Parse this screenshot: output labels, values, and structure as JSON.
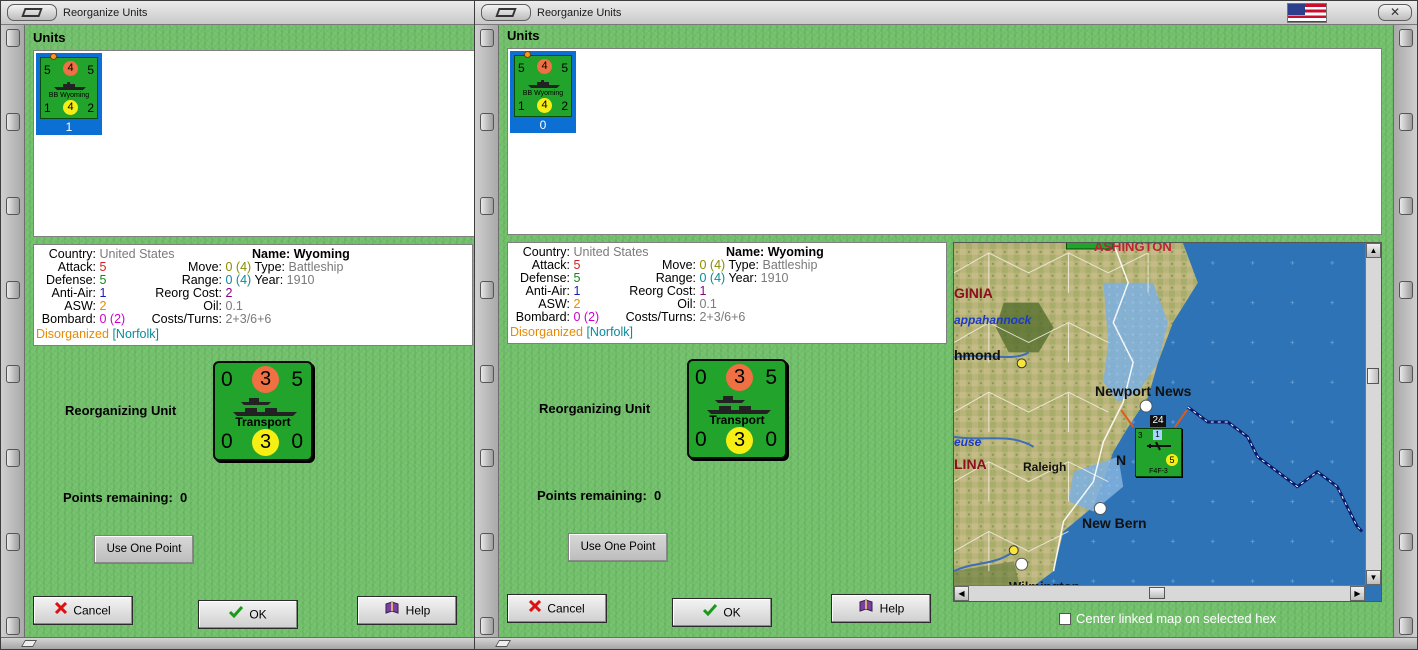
{
  "left_window": {
    "title": "Reorganize Units",
    "units_heading": "Units",
    "unit": {
      "attack_left": "5",
      "attack_circle": "4",
      "attack_right": "5",
      "defense_left": "1",
      "defense_circle": "4",
      "defense_right": "2",
      "name_label": "BB Wyoming",
      "count": "1"
    },
    "stats": {
      "country_label": "Country:",
      "country_value": "United States",
      "name_label": "Name:",
      "name_value": "Wyoming",
      "attack_label": "Attack:",
      "attack_value": "5",
      "defense_label": "Defense:",
      "defense_value": "5",
      "antiair_label": "Anti-Air:",
      "antiair_value": "1",
      "asw_label": "ASW:",
      "asw_value": "2",
      "bombard_label": "Bombard:",
      "bombard_value": "0",
      "bombard_paren": "(2)",
      "move_label": "Move:",
      "move_value": "0",
      "move_paren": "(4)",
      "type_label": "Type:",
      "type_value": "Battleship",
      "range_label": "Range:",
      "range_value": "0",
      "range_paren": "(4)",
      "year_label": "Year:",
      "year_value": "1910",
      "reorg_label": "Reorg Cost:",
      "reorg_value": "2",
      "oil_label": "Oil:",
      "oil_value": "0.1",
      "costs_label": "Costs/Turns:",
      "costs_value": "2+3/6+6",
      "status": "Disorganized",
      "location": "[Norfolk]"
    },
    "reorganizing_label": "Reorganizing Unit",
    "transport": {
      "top_left": "0",
      "top_circle": "3",
      "top_right": "5",
      "bottom_left": "0",
      "bottom_circle": "3",
      "bottom_right": "0",
      "label": "Transport"
    },
    "points_label": "Points remaining:",
    "points_value": "0",
    "use_point_button": "Use One Point",
    "cancel_button": "Cancel",
    "ok_button": "OK",
    "help_button": "Help"
  },
  "right_window": {
    "title": "Reorganize Units",
    "units_heading": "Units",
    "unit": {
      "attack_left": "5",
      "attack_circle": "4",
      "attack_right": "5",
      "defense_left": "1",
      "defense_circle": "4",
      "defense_right": "2",
      "name_label": "BB Wyoming",
      "count": "0"
    },
    "stats": {
      "country_label": "Country:",
      "country_value": "United States",
      "name_label": "Name:",
      "name_value": "Wyoming",
      "attack_label": "Attack:",
      "attack_value": "5",
      "defense_label": "Defense:",
      "defense_value": "5",
      "antiair_label": "Anti-Air:",
      "antiair_value": "1",
      "asw_label": "ASW:",
      "asw_value": "2",
      "bombard_label": "Bombard:",
      "bombard_value": "0",
      "bombard_paren": "(2)",
      "move_label": "Move:",
      "move_value": "0",
      "move_paren": "(4)",
      "type_label": "Type:",
      "type_value": "Battleship",
      "range_label": "Range:",
      "range_value": "0",
      "range_paren": "(4)",
      "year_label": "Year:",
      "year_value": "1910",
      "reorg_label": "Reorg Cost:",
      "reorg_value": "1",
      "oil_label": "Oil:",
      "oil_value": "0.1",
      "costs_label": "Costs/Turns:",
      "costs_value": "2+3/6+6",
      "status": "Disorganized",
      "location": "[Norfolk]"
    },
    "reorganizing_label": "Reorganizing Unit",
    "transport": {
      "top_left": "0",
      "top_circle": "3",
      "top_right": "5",
      "bottom_left": "0",
      "bottom_circle": "3",
      "bottom_right": "0",
      "label": "Transport"
    },
    "points_label": "Points remaining:",
    "points_value": "0",
    "use_point_button": "Use One Point",
    "cancel_button": "Cancel",
    "ok_button": "OK",
    "help_button": "Help",
    "map": {
      "labels": {
        "washington": "ASHINGTON",
        "virginia": "GINIA",
        "rappahannock": "appahannock",
        "richmond": "hmond",
        "newport_news": "Newport News",
        "neuse": "euse",
        "carolina": "LINA",
        "raleigh": "Raleigh",
        "norfolk_partial": "N",
        "new_bern": "New Bern",
        "wilmington": "Wilmington",
        "stack_count": "24",
        "unit_strength": "5",
        "unit_type": "F4F-3",
        "unit_attack": "3",
        "unit_defense": "1"
      }
    },
    "center_checkbox_label": "Center linked map on selected hex"
  },
  "icons": {
    "cancel": "x-icon",
    "ok": "checkmark-icon",
    "help": "help-book-icon",
    "flag": "us-flag-icon"
  },
  "colors": {
    "felt_green": "#73c16c",
    "counter_green": "#22a32b",
    "selection_blue": "#0c6fd4",
    "attack_circle": "#ee7043",
    "defense_circle": "#f7ee14",
    "sea_blue": "#2e73b6"
  }
}
